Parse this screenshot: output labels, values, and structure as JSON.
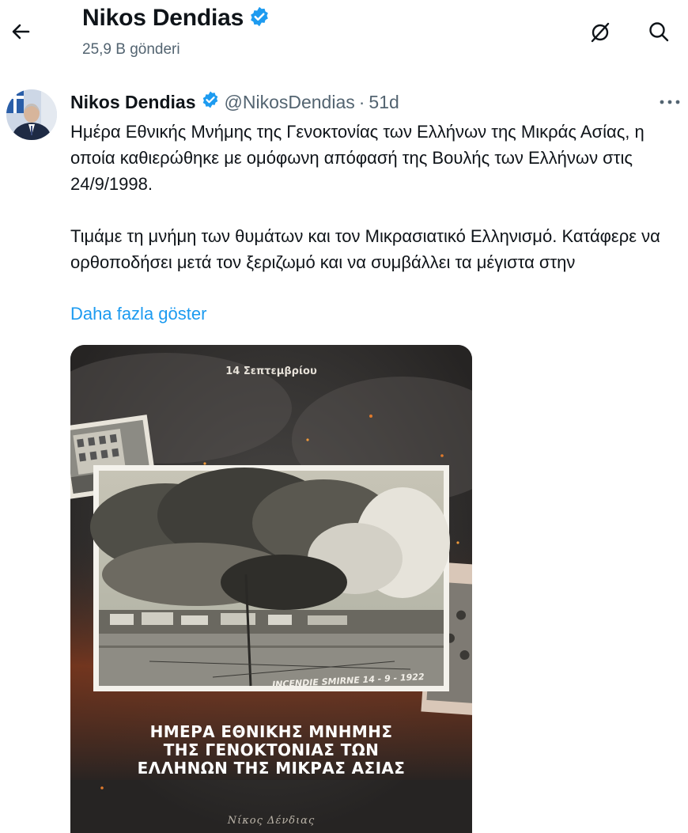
{
  "header": {
    "title": "Nikos Dendias",
    "post_count": "25,9 B gönderi",
    "icons": [
      "back-arrow-icon",
      "verified-badge-icon",
      "no-notifications-icon",
      "search-icon"
    ]
  },
  "tweet": {
    "author_name": "Nikos Dendias",
    "handle": "@NikosDendias",
    "separator": "·",
    "time": "51d",
    "paragraph_1": "Ημέρα Εθνικής Μνήμης της Γενοκτονίας των Ελλήνων της Μικράς Ασίας, η οποία καθιερώθηκε με ομόφωνη απόφασή της Βουλής των Ελλήνων στις 24/9/1998.",
    "paragraph_2": "Τιμάμε τη μνήμη των θυμάτων και τον Μικρασιατικό Ελληνισμό. Κατάφερε να ορθοποδήσει μετά τον ξεριζωμό και να συμβάλλει τα μέγιστα στην",
    "show_more": "Daha fazla göster"
  },
  "media": {
    "date": "14 Σεπτεμβρίου",
    "photo_caption": "INCENDIE SMIRNE 14 - 9 - 1922",
    "title_lines": [
      "ΗΜΕΡΑ ΕΘΝΙΚΗΣ ΜΝΗΜΗΣ",
      "ΤΗΣ ΓΕΝΟΚΤΟΝΙΑΣ ΤΩΝ",
      "ΕΛΛΗΝΩΝ ΤΗΣ ΜΙΚΡΑΣ ΑΣΙΑΣ"
    ],
    "signature": "Νίκος Δένδιας"
  },
  "colors": {
    "link": "#1d9bf0",
    "secondary_text": "#536471",
    "verified": "#1d9bf0"
  }
}
